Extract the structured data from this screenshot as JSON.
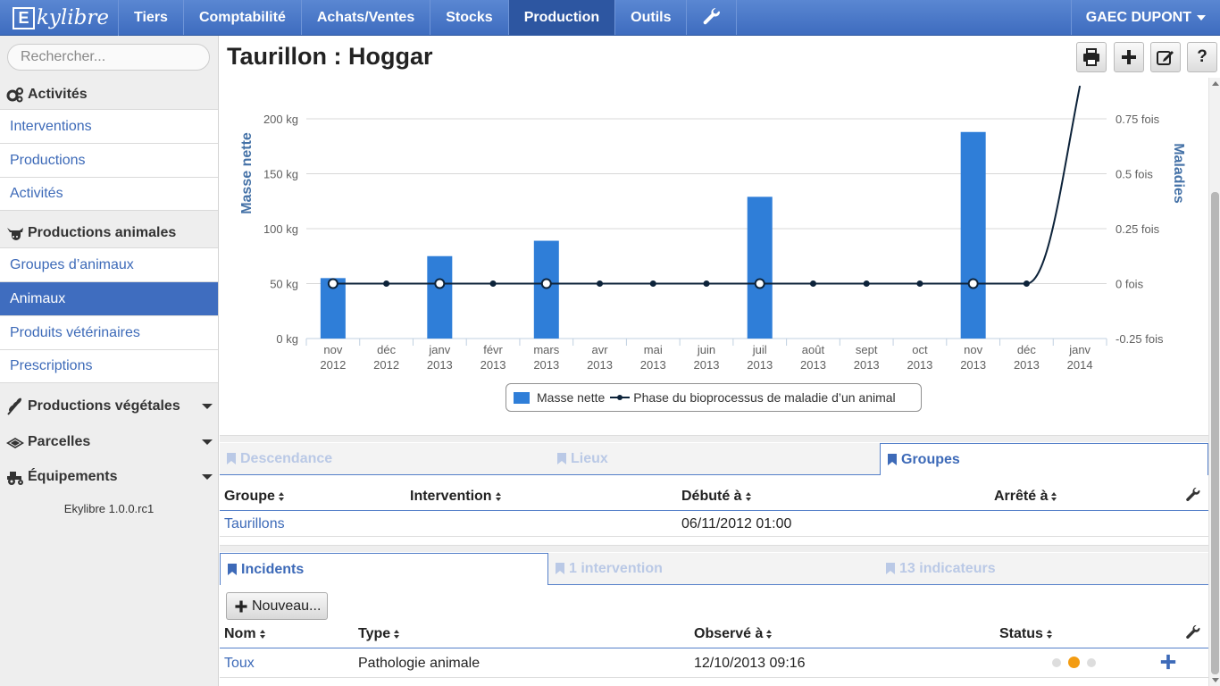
{
  "app": {
    "logo_letter": "E",
    "logo_text": "kylibre",
    "nav": [
      "Tiers",
      "Comptabilité",
      "Achats/Ventes",
      "Stocks",
      "Production",
      "Outils"
    ],
    "active_nav": "Production",
    "company": "GAEC DUPONT",
    "version": "Ekylibre 1.0.0.rc1"
  },
  "sidebar": {
    "search_placeholder": "Rechercher...",
    "sections": [
      {
        "label": "Activités",
        "icon": "gears-icon",
        "items": [
          "Interventions",
          "Productions",
          "Activités"
        ]
      },
      {
        "label": "Productions animales",
        "icon": "cow-icon",
        "items": [
          "Groupes d’animaux",
          "Animaux",
          "Produits vétérinaires",
          "Prescriptions"
        ]
      },
      {
        "label": "Productions végétales",
        "icon": "wheat-icon",
        "collapsed": true
      },
      {
        "label": "Parcelles",
        "icon": "land-icon",
        "collapsed": true
      },
      {
        "label": "Équipements",
        "icon": "tractor-icon",
        "collapsed": true
      }
    ],
    "active_item": "Animaux"
  },
  "page": {
    "title": "Taurillon : Hoggar",
    "toolbar": [
      "print-icon",
      "plus-icon",
      "edit-icon",
      "help-icon"
    ],
    "help_label": "?"
  },
  "chart_data": {
    "type": "bar",
    "left_axis": {
      "label": "Masse nette",
      "ticks": [
        "200 kg",
        "150 kg",
        "100 kg",
        "50 kg",
        "0 kg"
      ],
      "ylim": [
        0,
        200
      ]
    },
    "right_axis": {
      "label": "Maladies",
      "ticks": [
        "0.75 fois",
        "0.5 fois",
        "0.25 fois",
        "0 fois",
        "-0.25 fois"
      ],
      "ylim": [
        -0.25,
        0.75
      ]
    },
    "categories": [
      [
        "nov",
        "2012"
      ],
      [
        "déc",
        "2012"
      ],
      [
        "janv",
        "2013"
      ],
      [
        "févr",
        "2013"
      ],
      [
        "mars",
        "2013"
      ],
      [
        "avr",
        "2013"
      ],
      [
        "mai",
        "2013"
      ],
      [
        "juin",
        "2013"
      ],
      [
        "juil",
        "2013"
      ],
      [
        "août",
        "2013"
      ],
      [
        "sept",
        "2013"
      ],
      [
        "oct",
        "2013"
      ],
      [
        "nov",
        "2013"
      ],
      [
        "déc",
        "2013"
      ],
      [
        "janv",
        "2014"
      ]
    ],
    "series": [
      {
        "name": "Masse nette",
        "type": "bar",
        "color": "#2f7ed8",
        "values": [
          55,
          null,
          75,
          null,
          89,
          null,
          null,
          null,
          129,
          null,
          null,
          null,
          188,
          null,
          null
        ]
      },
      {
        "name": "Phase du bioprocessus de maladie d’un animal",
        "type": "line",
        "color": "#0d233a",
        "values": [
          0,
          0,
          0,
          0,
          0,
          0,
          0,
          0,
          0,
          0,
          0,
          0,
          0,
          0,
          0.9
        ]
      }
    ],
    "legend_position": "bottom-center",
    "grid": true
  },
  "tabs1": {
    "items": [
      "Descendance",
      "Lieux",
      "Groupes"
    ],
    "active": "Groupes",
    "columns": [
      "Groupe",
      "Intervention",
      "Débuté à",
      "Arrêté à"
    ],
    "rows": [
      {
        "groupe": "Taurillons",
        "intervention": "",
        "debut": "06/11/2012 01:00",
        "arret": ""
      }
    ]
  },
  "tabs2": {
    "items": [
      "Incidents",
      "1 intervention",
      "13 indicateurs"
    ],
    "active": "Incidents",
    "new_button": "Nouveau...",
    "columns": [
      "Nom",
      "Type",
      "Observé à",
      "Status"
    ],
    "rows": [
      {
        "nom": "Toux",
        "type": "Pathologie animale",
        "observe": "12/10/2013 09:16",
        "status": "orange"
      }
    ]
  },
  "colors": {
    "accent": "#3f6dbf",
    "bar": "#2f7ed8",
    "line": "#0d233a",
    "status_active": "#f39c12",
    "status_inactive": "#dddddd"
  }
}
